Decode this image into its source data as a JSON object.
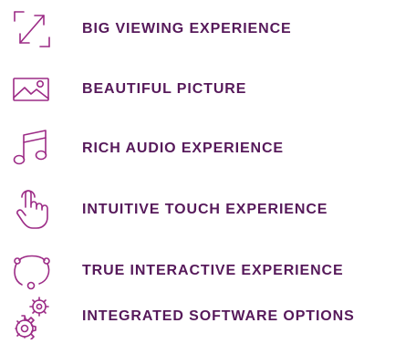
{
  "colors": {
    "icon": "#9c2b86",
    "label": "#56195a"
  },
  "features": [
    {
      "icon": "expand-arrows-icon",
      "label": "BIG VIEWING EXPERIENCE"
    },
    {
      "icon": "picture-icon",
      "label": "BEAUTIFUL PICTURE"
    },
    {
      "icon": "music-note-icon",
      "label": "RICH AUDIO EXPERIENCE"
    },
    {
      "icon": "touch-hand-icon",
      "label": "INTUITIVE TOUCH EXPERIENCE"
    },
    {
      "icon": "network-nodes-icon",
      "label": "TRUE INTERACTIVE EXPERIENCE"
    },
    {
      "icon": "gears-icon",
      "label": "INTEGRATED SOFTWARE OPTIONS"
    }
  ]
}
